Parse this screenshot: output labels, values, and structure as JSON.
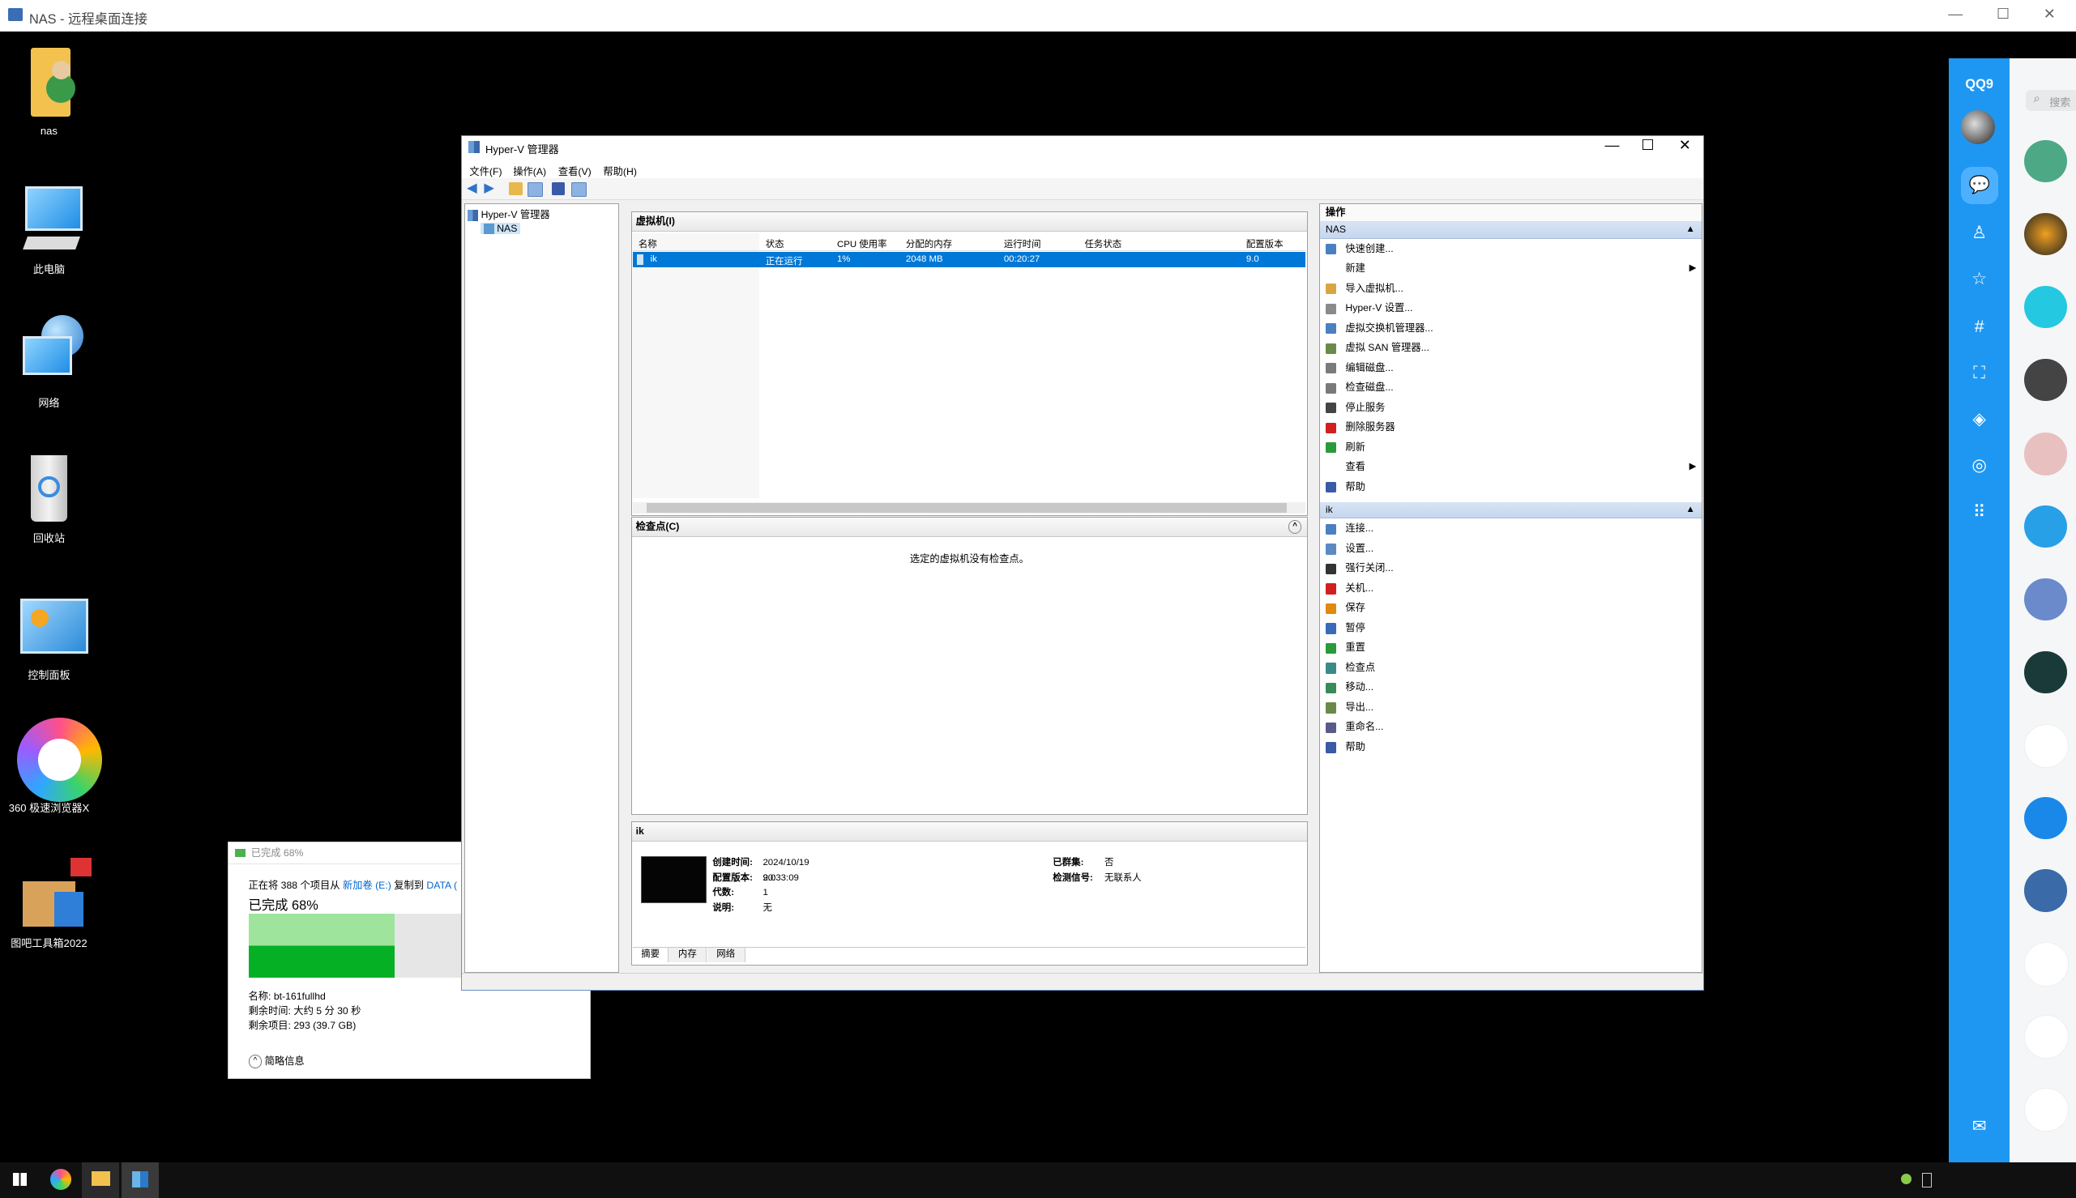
{
  "rdp": {
    "title": "NAS - 远程桌面连接",
    "minimize": "—",
    "maximize": "☐",
    "close": "✕"
  },
  "desktop": {
    "icons": [
      {
        "label": "nas"
      },
      {
        "label": "此电脑"
      },
      {
        "label": "网络"
      },
      {
        "label": "回收站"
      },
      {
        "label": "控制面板"
      },
      {
        "label": "360 极速浏览器X"
      },
      {
        "label": "图吧工具箱2022"
      }
    ]
  },
  "hyperv": {
    "title": "Hyper-V 管理器",
    "window_controls": {
      "minimize": "—",
      "maximize": "☐",
      "close": "✕"
    },
    "menu": [
      "文件(F)",
      "操作(A)",
      "查看(V)",
      "帮助(H)"
    ],
    "tree": {
      "root": "Hyper-V 管理器",
      "server": "NAS"
    },
    "vm_pane": {
      "title": "虚拟机(I)",
      "columns": [
        "名称",
        "状态",
        "CPU 使用率",
        "分配的内存",
        "运行时间",
        "任务状态",
        "配置版本"
      ],
      "rows": [
        {
          "name": "ik",
          "state": "正在运行",
          "cpu": "1%",
          "memory": "2048 MB",
          "uptime": "00:20:27",
          "task": "",
          "version": "9.0"
        }
      ]
    },
    "checkpoint_pane": {
      "title": "检查点(C)",
      "empty_msg": "选定的虚拟机没有检查点。"
    },
    "details_pane": {
      "title": "ik",
      "fields_left": [
        {
          "label": "创建时间:",
          "value": "2024/10/19 20:33:09"
        },
        {
          "label": "配置版本:",
          "value": "9.0"
        },
        {
          "label": "代数:",
          "value": "1"
        },
        {
          "label": "说明:",
          "value": "无"
        }
      ],
      "fields_right": [
        {
          "label": "已群集:",
          "value": "否"
        },
        {
          "label": "检测信号:",
          "value": "无联系人"
        }
      ],
      "tabs": [
        "摘要",
        "内存",
        "网络"
      ]
    },
    "actions": {
      "title": "操作",
      "server_group": "NAS",
      "server_items": [
        {
          "label": "快速创建...",
          "icon": "quick-create-icon",
          "color": "#4a7fc1"
        },
        {
          "label": "新建",
          "icon": "new-icon",
          "color": "",
          "submenu": true
        },
        {
          "label": "导入虚拟机...",
          "icon": "import-icon",
          "color": "#d8a640"
        },
        {
          "label": "Hyper-V 设置...",
          "icon": "settings-icon",
          "color": "#8a8a8a"
        },
        {
          "label": "虚拟交换机管理器...",
          "icon": "switch-icon",
          "color": "#4a7fc1"
        },
        {
          "label": "虚拟 SAN 管理器...",
          "icon": "san-icon",
          "color": "#6a8a4a"
        },
        {
          "label": "编辑磁盘...",
          "icon": "edit-disk-icon",
          "color": "#7a7a7a"
        },
        {
          "label": "检查磁盘...",
          "icon": "inspect-disk-icon",
          "color": "#7a7a7a"
        },
        {
          "label": "停止服务",
          "icon": "stop-icon",
          "color": "#444444"
        },
        {
          "label": "删除服务器",
          "icon": "delete-icon",
          "color": "#d02020"
        },
        {
          "label": "刷新",
          "icon": "refresh-icon",
          "color": "#2a9a3a"
        },
        {
          "label": "查看",
          "icon": "view-icon",
          "color": "",
          "submenu": true
        },
        {
          "label": "帮助",
          "icon": "help-icon",
          "color": "#3a5aa8"
        }
      ],
      "vm_group": "ik",
      "vm_items": [
        {
          "label": "连接...",
          "icon": "connect-icon",
          "color": "#4a7fc1"
        },
        {
          "label": "设置...",
          "icon": "settings-icon",
          "color": "#5a8ac1"
        },
        {
          "label": "强行关闭...",
          "icon": "turn-off-icon",
          "color": "#333333"
        },
        {
          "label": "关机...",
          "icon": "shutdown-icon",
          "color": "#d02020"
        },
        {
          "label": "保存",
          "icon": "save-icon",
          "color": "#e08a10"
        },
        {
          "label": "暂停",
          "icon": "pause-icon",
          "color": "#3a6ab8"
        },
        {
          "label": "重置",
          "icon": "reset-icon",
          "color": "#2a9a3a"
        },
        {
          "label": "检查点",
          "icon": "checkpoint-icon",
          "color": "#3a8a8a"
        },
        {
          "label": "移动...",
          "icon": "move-icon",
          "color": "#3a8a5a"
        },
        {
          "label": "导出...",
          "icon": "export-icon",
          "color": "#6a8a4a"
        },
        {
          "label": "重命名...",
          "icon": "rename-icon",
          "color": "#5a5a8a"
        },
        {
          "label": "帮助",
          "icon": "help-icon",
          "color": "#3a5aa8"
        }
      ]
    }
  },
  "copy_dialog": {
    "header": "已完成 68%",
    "line_prefix": "正在将 388 个项目从",
    "src": "新加卷 (E:)",
    "mid": "复制到",
    "dst": "DATA (",
    "progress_text": "已完成 68%",
    "progress": 68,
    "name": "名称: bt-161fullhd",
    "time_left": "剩余时间: 大约 5 分 30 秒",
    "items_left": "剩余项目: 293 (39.7 GB)",
    "less_info": "简略信息"
  },
  "qq": {
    "logo": "QQ9",
    "search_placeholder": "搜索"
  },
  "colors": {
    "accent": "#0078d7",
    "qq_blue": "#1e97f2",
    "progress_green": "#06b025"
  }
}
